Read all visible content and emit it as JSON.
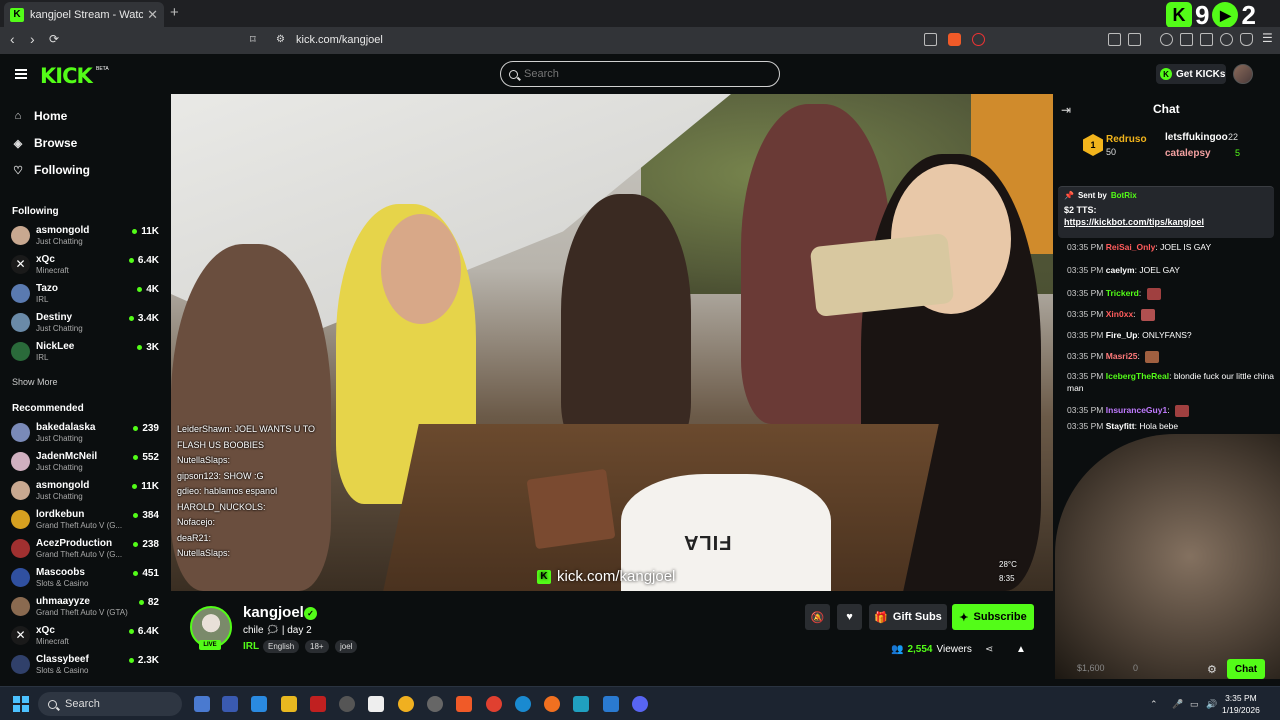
{
  "browser": {
    "tab_title": "kangjoel Stream - Watch Live",
    "url": "kick.com/kangjoel",
    "overlay_numbers": [
      "9",
      "2"
    ]
  },
  "header": {
    "logo": "KICK",
    "beta": "BETA",
    "search_placeholder": "Search",
    "get_kicks": "Get KICKs"
  },
  "sidebar": {
    "nav": [
      {
        "label": "Home",
        "icon": "home-icon"
      },
      {
        "label": "Browse",
        "icon": "compass-icon"
      },
      {
        "label": "Following",
        "icon": "heart-icon"
      }
    ],
    "following_title": "Following",
    "following": [
      {
        "name": "asmongold",
        "category": "Just Chatting",
        "viewers": "11K"
      },
      {
        "name": "xQc",
        "category": "Minecraft",
        "viewers": "6.4K"
      },
      {
        "name": "Tazo",
        "category": "IRL",
        "viewers": "4K"
      },
      {
        "name": "Destiny",
        "category": "Just Chatting",
        "viewers": "3.4K"
      },
      {
        "name": "NickLee",
        "category": "IRL",
        "viewers": "3K"
      }
    ],
    "show_more": "Show More",
    "recommended_title": "Recommended",
    "recommended": [
      {
        "name": "bakedalaska",
        "category": "Just Chatting",
        "viewers": "239"
      },
      {
        "name": "JadenMcNeil",
        "category": "Just Chatting",
        "viewers": "552"
      },
      {
        "name": "asmongold",
        "category": "Just Chatting",
        "viewers": "11K"
      },
      {
        "name": "lordkebun",
        "category": "Grand Theft Auto V (G...",
        "viewers": "384"
      },
      {
        "name": "AcezProduction",
        "category": "Grand Theft Auto V (G...",
        "viewers": "238"
      },
      {
        "name": "Mascoobs",
        "category": "Slots & Casino",
        "viewers": "451"
      },
      {
        "name": "uhmaayyze",
        "category": "Grand Theft Auto V (GTA)",
        "viewers": "82"
      },
      {
        "name": "xQc",
        "category": "Minecraft",
        "viewers": "6.4K"
      },
      {
        "name": "Classybeef",
        "category": "Slots & Casino",
        "viewers": "2.3K"
      }
    ]
  },
  "video": {
    "watermark": "kick.com/kangjoel",
    "fila": "FILA",
    "weather_temp": "28°C",
    "weather_time": "8:35",
    "overlay_chat": [
      "LeiderShawn: JOEL WANTS U TO",
      "FLASH US BOOBIES",
      "NutellaSlaps:",
      "gipson123: SHOW :G",
      "gdieo: hablamos espanol",
      "HAROLD_NUCKOLS:",
      "Nofacejo:",
      "deaR21:",
      "NutellaSlaps:"
    ]
  },
  "stream": {
    "name": "kangjoel",
    "title": "chile 🗯 | day 2",
    "category": "IRL",
    "tags": [
      "English",
      "18+",
      "joel"
    ],
    "live": "LIVE",
    "gift_subs": "Gift Subs",
    "subscribe": "Subscribe",
    "viewers": "2,554",
    "viewers_label": "Viewers"
  },
  "chat": {
    "title": "Chat",
    "leaderboard": [
      {
        "rank": "1",
        "name": "Redruso",
        "value": "50"
      },
      {
        "name": "letsffukingoo",
        "value": "22"
      },
      {
        "name": "catalepsy",
        "value": "5"
      }
    ],
    "pinned": {
      "sent_by": "Sent by",
      "bot": "BotRix",
      "line1": "$2 TTS:",
      "line2": "https://kickbot.com/tips/kangjoel"
    },
    "messages": [
      {
        "time": "03:35 PM",
        "user": "ReiSai_Only",
        "color": "#ff5c5c",
        "text": "JOEL IS GAY"
      },
      {
        "time": "03:35 PM",
        "user": "caelym",
        "color": "#ffffff",
        "text": "JOEL GAY"
      },
      {
        "time": "03:35 PM",
        "user": "Trickerd",
        "color": "#53fc18",
        "text": ""
      },
      {
        "time": "03:35 PM",
        "user": "Xin0xx",
        "color": "#ff5c5c",
        "text": ""
      },
      {
        "time": "03:35 PM",
        "user": "Fire_Up",
        "color": "#ffffff",
        "text": "ONLYFANS?"
      },
      {
        "time": "03:35 PM",
        "user": "Masri25",
        "color": "#ff7a7a",
        "text": ""
      },
      {
        "time": "03:35 PM",
        "user": "IcebergTheReal",
        "color": "#53fc18",
        "text": "blondie fuck our little china man"
      },
      {
        "time": "03:35 PM",
        "user": "InsuranceGuy1",
        "color": "#c07bff",
        "text": ""
      },
      {
        "time": "03:35 PM",
        "user": "Stayfitt",
        "color": "#ffffff",
        "text": "Hola bebe"
      }
    ],
    "kicks_count": "$1,600",
    "zero": "0",
    "send": "Chat"
  },
  "taskbar": {
    "search": "Search",
    "time": "3:35 PM",
    "date": "1/19/2026"
  },
  "colors": {
    "accent": "#53fc18",
    "bg": "#0b0e0f",
    "panel": "#24272c"
  }
}
